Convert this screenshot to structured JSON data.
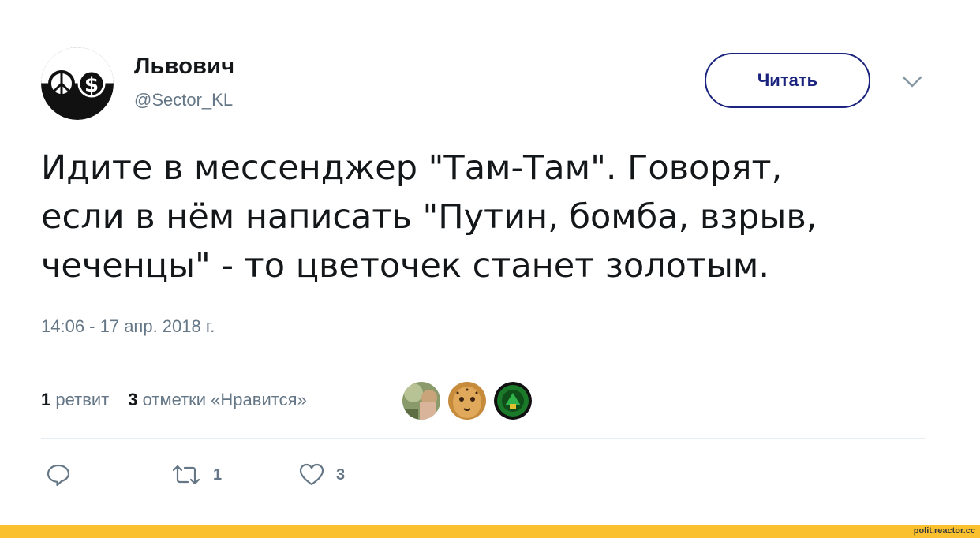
{
  "author": {
    "name": "Львович",
    "handle": "@Sector_KL"
  },
  "follow_button": {
    "label": "Читать"
  },
  "tweet": {
    "lines": [
      "Идите в мессенджер \"Там-Там\". Говорят,",
      "если в нём написать \"Путин, бомба, взрыв,",
      "чеченцы\" - то цветочек станет золотым."
    ],
    "timestamp": "14:06 - 17 апр. 2018 г."
  },
  "stats": {
    "retweets_count": "1",
    "retweets_label": "ретвит",
    "likes_count": "3",
    "likes_label": "отметки «Нравится»"
  },
  "actions": {
    "retweet_count": "1",
    "like_count": "3"
  },
  "colors": {
    "text": "#14171a",
    "secondary": "#657786",
    "button_border": "#1a237e",
    "footer": "#fbc02d"
  },
  "watermark": "polit.reactor.cc"
}
